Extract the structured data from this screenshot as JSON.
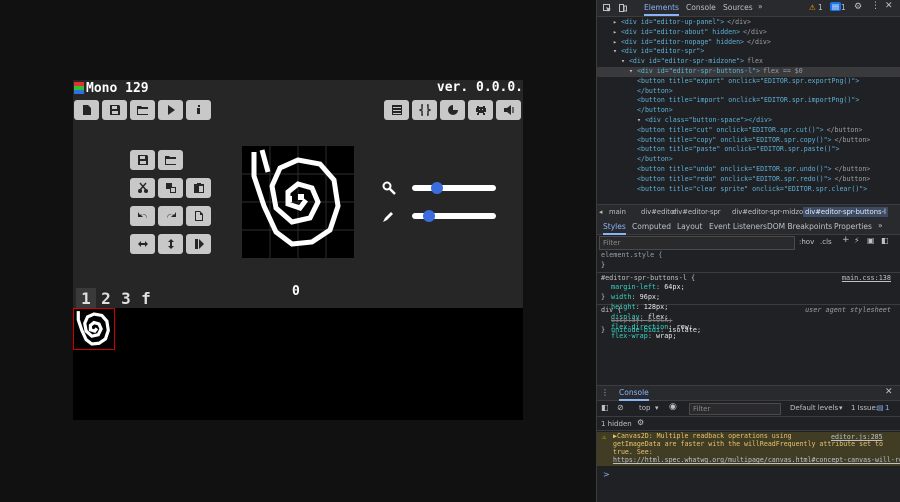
{
  "app": {
    "name": "Mono 129",
    "version": "ver. 0.0.0.",
    "counter": "0",
    "tabs": [
      "1",
      "2",
      "3",
      "f"
    ],
    "colors": {
      "bg": "#262626",
      "button": "#c8c8c8",
      "slider_knob": "#3b6dde",
      "selected_border": "#d00000"
    },
    "sliders": {
      "zoom_value": 0.3,
      "brush_value": 0.2
    },
    "toolbar_left_icons": [
      "new-file-icon",
      "save-icon",
      "open-folder-icon",
      "play-icon",
      "info-icon"
    ],
    "toolbar_right_icons": [
      "list-icon",
      "code-braces-icon",
      "pacman-icon",
      "invader-icon",
      "speaker-icon"
    ]
  },
  "devtools": {
    "tabs": [
      "Elements",
      "Console",
      "Sources"
    ],
    "issues_warn": "1",
    "issues_info": "1",
    "dom": [
      {
        "indent": 1,
        "text": "<div id=\"editor-up-panel\">",
        "tail": "</div>"
      },
      {
        "indent": 1,
        "text": "<div id=\"editor-about\" hidden>",
        "tail": "</div>"
      },
      {
        "indent": 1,
        "text": "<div id=\"editor-nopage\" hidden>",
        "tail": "</div>"
      },
      {
        "indent": 1,
        "text": "<div id=\"editor-spr\">",
        "tail": ""
      },
      {
        "indent": 2,
        "text": "<div id=\"editor-spr-midzone\">",
        "tail": "flex"
      },
      {
        "indent": 3,
        "text": "<div id=\"editor-spr-buttons-l\">",
        "tail": "flex == $0",
        "selected": true
      },
      {
        "indent": 4,
        "text": "<button title=\"export\" onclick=\"EDITOR.spr.exportPng()\">",
        "tail": ""
      },
      {
        "indent": 4,
        "text": "</button>",
        "tail": ""
      },
      {
        "indent": 4,
        "text": "<button title=\"import\" onclick=\"EDITOR.spr.importPng()\">",
        "tail": ""
      },
      {
        "indent": 4,
        "text": "</button>",
        "tail": ""
      },
      {
        "indent": 4,
        "text": "<div class=\"button-space\"></div>",
        "tail": ""
      },
      {
        "indent": 4,
        "text": "<button title=\"cut\" onclick=\"EDITOR.spr.cut()\">",
        "tail": "</button>"
      },
      {
        "indent": 4,
        "text": "<button title=\"copy\" onclick=\"EDITOR.spr.copy()\">",
        "tail": "</button>"
      },
      {
        "indent": 4,
        "text": "<button title=\"paste\" onclick=\"EDITOR.spr.paste()\">",
        "tail": ""
      },
      {
        "indent": 4,
        "text": "</button>",
        "tail": ""
      },
      {
        "indent": 4,
        "text": "<button title=\"undo\" onclick=\"EDITOR.spr.undo()\">",
        "tail": "</button>"
      },
      {
        "indent": 4,
        "text": "<button title=\"redo\" onclick=\"EDITOR.spr.redo()\">",
        "tail": "</button>"
      },
      {
        "indent": 4,
        "text": "<button title=\"clear sprite\" onclick=\"EDITOR.spr.clear()\">",
        "tail": ""
      }
    ],
    "breadcrumbs": [
      "main",
      "div#editor",
      "div#editor-spr",
      "div#editor-spr-midzone",
      "div#editor-spr-buttons-l"
    ],
    "style_tabs": [
      "Styles",
      "Computed",
      "Layout",
      "Event Listeners",
      "DOM Breakpoints",
      "Properties"
    ],
    "filter_placeholder": "Filter",
    "filter_hov": ":hov",
    "filter_cls": ".cls",
    "element_style_line": "element.style {",
    "rule_selector": "#editor-spr-buttons-l {",
    "rule_source": "main.css:138",
    "rule_props": [
      {
        "name": "margin-left",
        "value": "64px;"
      },
      {
        "name": "width",
        "value": "96px;"
      },
      {
        "name": "height",
        "value": "128px;"
      },
      {
        "name": "display",
        "value": "flex;"
      },
      {
        "name": "flex-direction",
        "value": "row;"
      },
      {
        "name": "flex-wrap",
        "value": "wrap;"
      }
    ],
    "ua_selector": "div {",
    "ua_source": "user agent stylesheet",
    "ua_props": [
      {
        "name": "display",
        "value": "block;",
        "struck": true
      },
      {
        "name": "unicode-bidi",
        "value": "isolate;",
        "struck": false
      }
    ],
    "close_brace": "}",
    "console": {
      "title": "Console",
      "context": "top",
      "filter_placeholder": "Filter",
      "levels": "Default levels",
      "issues": "1 Issue:",
      "issues_count": "1",
      "hidden": "1 hidden",
      "warning_lines": [
        "▶Canvas2D: Multiple readback operations using",
        "getImageData are faster with the willReadFrequently attribute set to",
        "true. See:",
        "https://html.spec.whatwg.org/multipage/canvas.html#concept-canvas-will-rea"
      ],
      "warning_source": "editor.js:285",
      "prompt": ">"
    }
  }
}
